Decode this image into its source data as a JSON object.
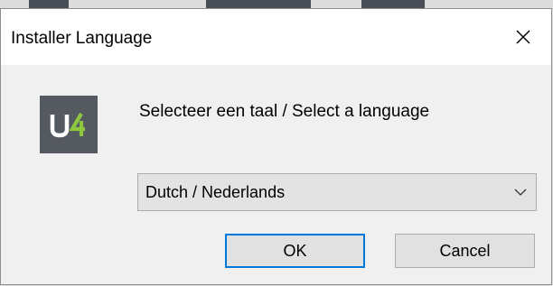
{
  "window": {
    "title": "Installer Language",
    "close_icon": "close-icon"
  },
  "app_icon": {
    "logo_text": "U4",
    "icon": "u4-logo-icon",
    "background_color": "#555a60",
    "letter_color": "#ffffff",
    "accent_color": "#8dc63f"
  },
  "prompt": {
    "text": "Selecteer een taal / Select a language"
  },
  "language_select": {
    "selected_value": "Dutch / Nederlands",
    "chevron_icon": "chevron-down-icon"
  },
  "buttons": {
    "ok_label": "OK",
    "cancel_label": "Cancel"
  },
  "colors": {
    "focus_border": "#0078d7",
    "dialog_background": "#f0f0f0",
    "titlebar_background": "#ffffff"
  }
}
